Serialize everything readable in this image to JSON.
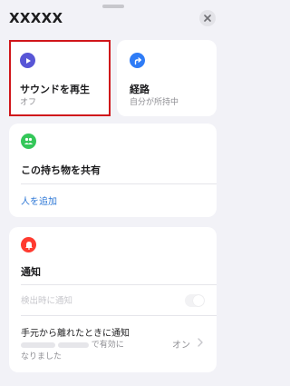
{
  "header": {
    "title": "XXXXX"
  },
  "play_sound": {
    "title": "サウンドを再生",
    "status": "オフ"
  },
  "directions": {
    "title": "経路",
    "status": "自分が所持中"
  },
  "share": {
    "title": "この持ち物を共有",
    "add_person": "人を追加"
  },
  "notifications": {
    "title": "通知",
    "when_found": "検出時に通知",
    "when_left_title": "手元から離れたときに通知",
    "when_left_detail_mid": "で有効に",
    "when_left_detail_end": "なりました",
    "when_left_value": "オン"
  },
  "colors": {
    "play_icon": "#5856d6",
    "directions_icon": "#2f7cf6",
    "share_icon": "#34c759",
    "notify_icon": "#ff3b30",
    "highlight": "#d0161b"
  }
}
